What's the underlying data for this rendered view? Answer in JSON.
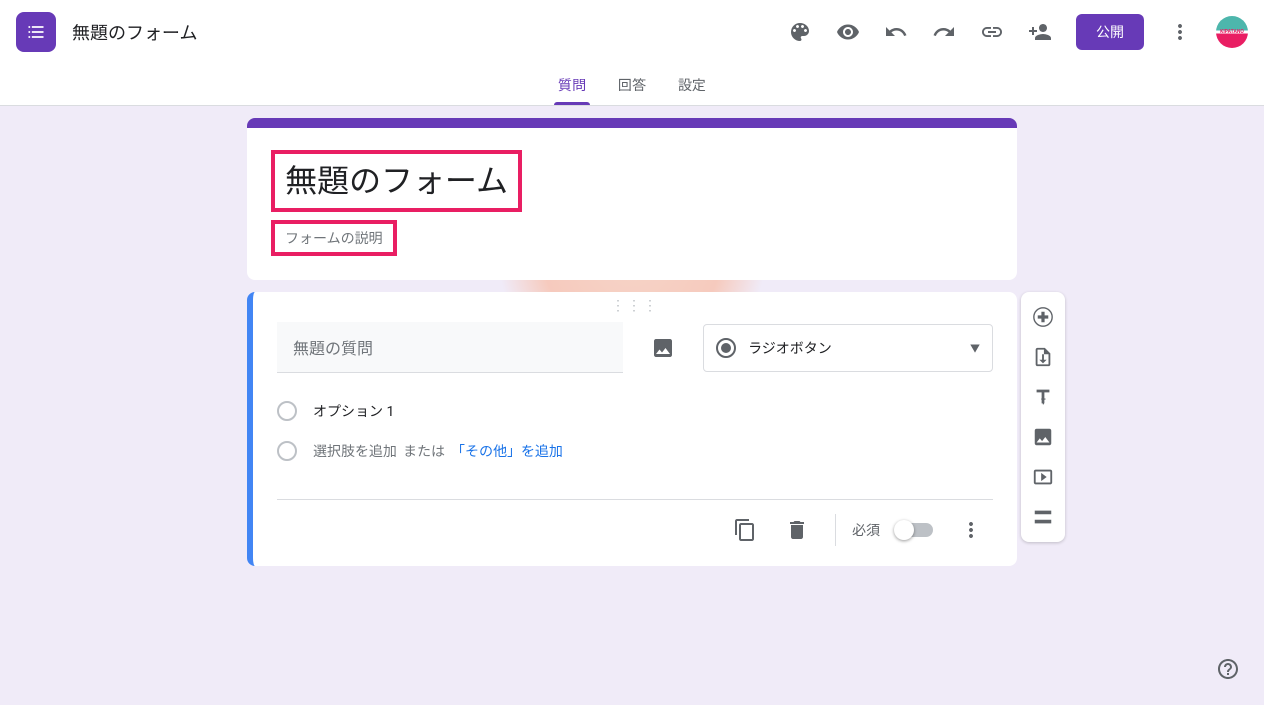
{
  "header": {
    "doc_title": "無題のフォーム",
    "publish_label": "公開",
    "avatar_text": "KIPATANO"
  },
  "tabs": {
    "questions": "質問",
    "responses": "回答",
    "settings": "設定"
  },
  "title_card": {
    "title": "無題のフォーム",
    "description": "フォームの説明"
  },
  "question": {
    "title": "無題の質問",
    "type_label": "ラジオボタン",
    "option1": "オプション 1",
    "add_option": "選択肢を追加",
    "or_text": "または",
    "add_other": "「その他」を追加"
  },
  "footer": {
    "required_label": "必須"
  }
}
